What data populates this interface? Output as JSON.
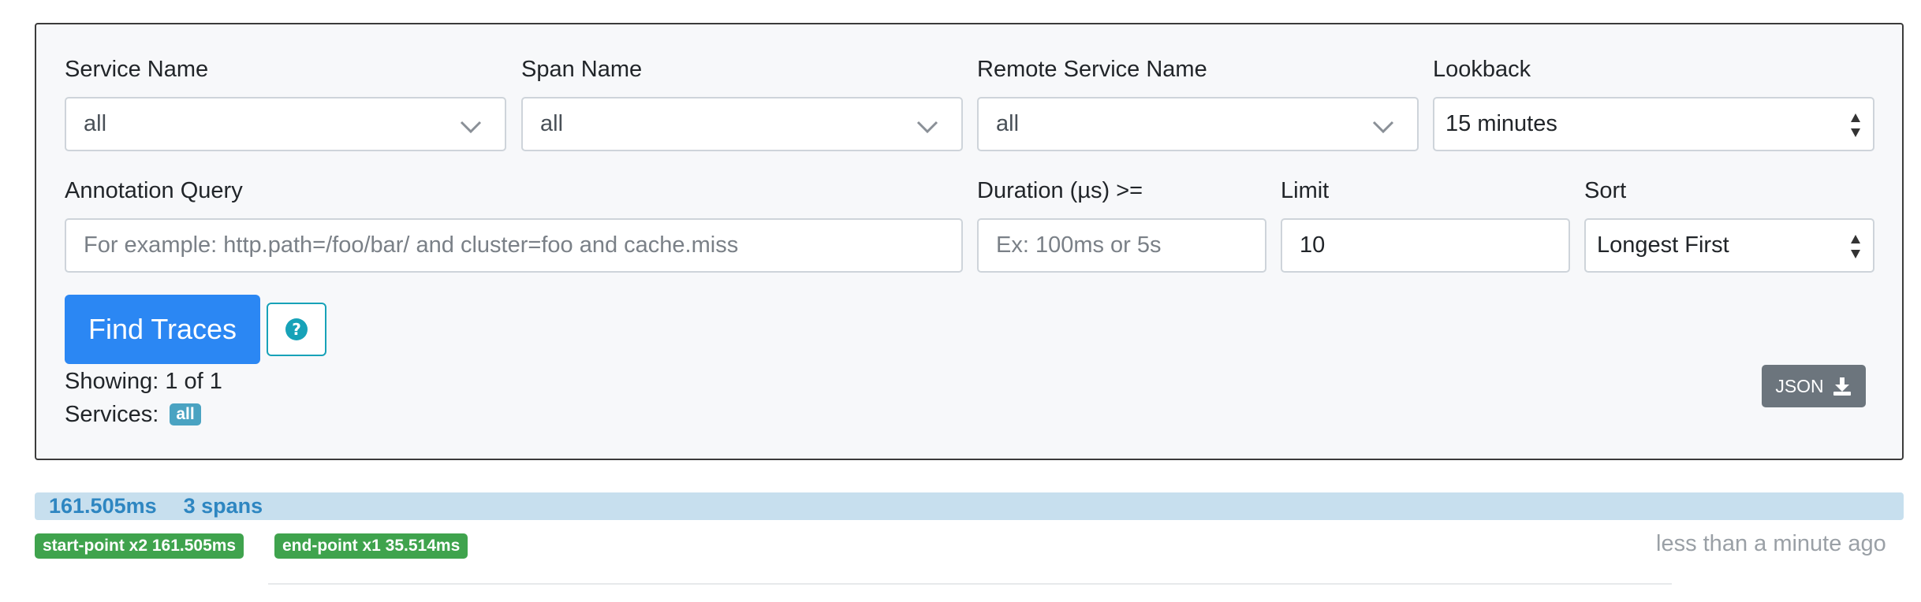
{
  "form": {
    "service_name": {
      "label": "Service Name",
      "value": "all"
    },
    "span_name": {
      "label": "Span Name",
      "value": "all"
    },
    "remote_service_name": {
      "label": "Remote Service Name",
      "value": "all"
    },
    "lookback": {
      "label": "Lookback",
      "value": "15 minutes"
    },
    "annotation_query": {
      "label": "Annotation Query",
      "value": "",
      "placeholder": "For example: http.path=/foo/bar/ and cluster=foo and cache.miss"
    },
    "duration": {
      "label": "Duration (µs) >=",
      "value": "",
      "placeholder": "Ex: 100ms or 5s"
    },
    "limit": {
      "label": "Limit",
      "value": "10"
    },
    "sort": {
      "label": "Sort",
      "value": "Longest First"
    },
    "find_button_label": "Find Traces",
    "help_icon": "question-circle-icon"
  },
  "results": {
    "showing": "Showing: 1 of 1",
    "services_label": "Services:",
    "services_badge": "all",
    "json_button_label": "JSON",
    "download_icon": "download-icon"
  },
  "traces": [
    {
      "duration": "161.505ms",
      "spans": "3 spans",
      "service_badges": [
        "start-point x2 161.505ms",
        "end-point x1 35.514ms"
      ],
      "timestamp": "less than a minute ago"
    }
  ],
  "colors": {
    "primary": "#2b87f3",
    "info": "#17a2b8",
    "success": "#3fa34d",
    "secondary": "#6c757d",
    "trace_bar": "#c7dfee"
  }
}
